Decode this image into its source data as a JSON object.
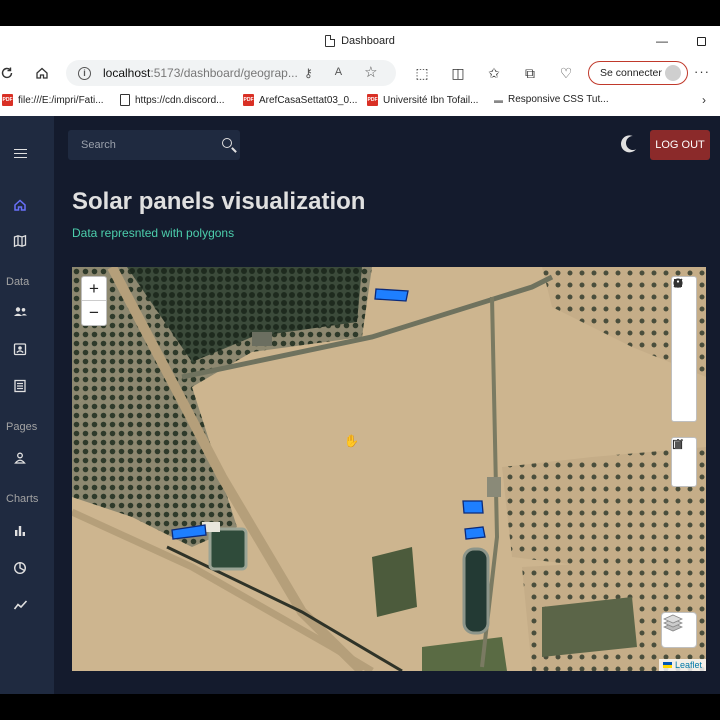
{
  "browser": {
    "tab_title": "Dashboard",
    "url_host": "localhost",
    "url_path": ":5173/dashboard/geograp...",
    "signin_label": "Se connecter",
    "bookmarks": [
      {
        "label": "file:///E:/impri/Fati...",
        "icon": "page-icon"
      },
      {
        "label": "https://cdn.discord...",
        "icon": "page-icon"
      },
      {
        "label": "ArefCasaSettat03_0...",
        "icon": "pdf-icon"
      },
      {
        "label": "Université Ibn Tofail...",
        "icon": "pdf-icon"
      },
      {
        "label": "Responsive CSS Tut...",
        "icon": "css-icon"
      }
    ]
  },
  "header": {
    "search_placeholder": "Search",
    "logout_label": "LOG OUT"
  },
  "sidebar": {
    "sections": {
      "data": "Data",
      "pages": "Pages",
      "charts": "Charts"
    }
  },
  "main": {
    "title": "Solar panels visualization",
    "subtitle": "Data represnted with polygons"
  },
  "map": {
    "zoom_in": "+",
    "zoom_out": "−",
    "attribution": "Leaflet",
    "polygon_color": "#1e7fff"
  },
  "colors": {
    "app_bg": "#141b2d",
    "sidebar_bg": "#1f2a40",
    "accent_green": "#4cceac",
    "logout_red": "#8b2a2a"
  }
}
